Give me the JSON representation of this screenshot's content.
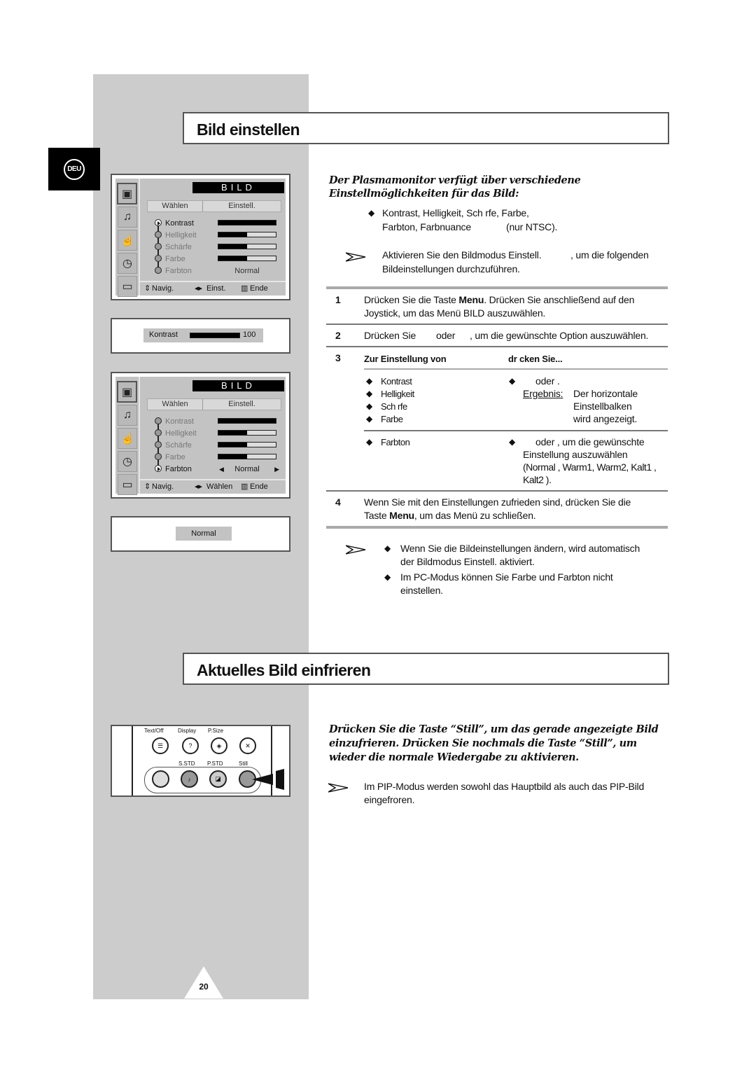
{
  "language_tab": "DEU",
  "section1": {
    "title": "Bild einstellen",
    "intro": "Der Plasmamonitor verfügt über verschiedene Einstellmöglichkeiten für das Bild:",
    "bullet_line1": "Kontrast, Helligkeit, Sch rfe, Farbe,",
    "bullet_line2_a": "Farbton, Farbnuance",
    "bullet_line2_b": "(nur NTSC).",
    "note_line1_a": "Aktivieren Sie den Bildmodus Einstell.",
    "note_line1_b": ", um die folgenden",
    "note_line2": "Bildeinstellungen durchzuführen.",
    "steps": [
      {
        "num": "1",
        "line1_a": "Drücken Sie die Taste ",
        "line1_bold": "Menu",
        "line1_b": ". Drücken Sie anschließend auf den",
        "line2": "Joystick, um das Menü BILD  auszuwählen."
      },
      {
        "num": "2",
        "a": "Drücken Sie",
        "b": "oder",
        "c": ", um die gewünschte Option auszuwählen."
      },
      {
        "num": "3",
        "col1": "Zur Einstellung von",
        "col2": "dr  cken Sie..."
      },
      {
        "num": "4",
        "line1": "Wenn Sie mit den Einstellungen zufrieden sind, drücken Sie die",
        "line2_a": "Taste ",
        "line2_bold": "Menu",
        "line2_b": ", um das Menü zu schließen."
      }
    ],
    "table": {
      "group1_items": [
        "Kontrast",
        "Helligkeit",
        "Sch  rfe",
        "Farbe"
      ],
      "group1_action": "oder   .",
      "group1_result_label": "Ergebnis:",
      "group1_result": [
        "Der horizontale",
        "Einstellbalken",
        "wird angezeigt."
      ],
      "group2_item": "Farbton",
      "group2_action": [
        "oder    , um die gewünschte",
        "Einstellung auszuwählen",
        "(Normal  , Warm1, Warm2, Kalt1    ,",
        "Kalt2    )."
      ]
    },
    "notes": [
      {
        "line1": "Wenn Sie die Bildeinstellungen ändern, wird automatisch",
        "line2": "der Bildmodus Einstell.        aktiviert."
      },
      {
        "line1": "Im PC-Modus können Sie Farbe  und Farbton     nicht",
        "line2": "einstellen."
      }
    ]
  },
  "osd1": {
    "title": "BILD",
    "col_select": "Wählen",
    "col_adjust": "Einstell.",
    "items": [
      {
        "label": "Kontrast",
        "level": 1.0,
        "selected": true
      },
      {
        "label": "Helligkeit",
        "level": 0.5,
        "selected": false
      },
      {
        "label": "Schärfe",
        "level": 0.5,
        "selected": false
      },
      {
        "label": "Farbe",
        "level": 0.5,
        "selected": false
      },
      {
        "label": "Farbton",
        "value": "Normal",
        "selected": false
      }
    ],
    "footer": {
      "nav": "Navig.",
      "adjust": "Einst.",
      "exit": "Ende"
    }
  },
  "info1": {
    "label": "Kontrast",
    "level": 1.0,
    "value": "100"
  },
  "osd2": {
    "title": "BILD",
    "col_select": "Wählen",
    "col_adjust": "Einstell.",
    "items": [
      {
        "label": "Kontrast",
        "level": 1.0,
        "selected": false
      },
      {
        "label": "Helligkeit",
        "level": 0.5,
        "selected": false
      },
      {
        "label": "Schärfe",
        "level": 0.5,
        "selected": false
      },
      {
        "label": "Farbe",
        "level": 0.5,
        "selected": false
      },
      {
        "label": "Farbton",
        "value": "Normal",
        "selected": true
      }
    ],
    "footer": {
      "nav": "Navig.",
      "adjust": "Wählen",
      "exit": "Ende"
    }
  },
  "info2": {
    "value": "Normal"
  },
  "section2": {
    "title": "Aktuelles Bild einfrieren",
    "intro": "Drücken Sie die Taste “Still”, um das gerade angezeigte Bild einzufrieren. Drücken Sie nochmals die Taste “Still”, um wieder die normale Wiedergabe zu aktivieren.",
    "note_line1": "Im PIP-Modus werden sowohl das Hauptbild als auch das PIP-Bild",
    "note_line2": "eingefroren."
  },
  "remote": {
    "labels_top": [
      "Text/Off",
      "Display",
      "P.Size"
    ],
    "labels_bottom": [
      "S.STD",
      "P.STD",
      "Still"
    ]
  },
  "page_number": "20"
}
